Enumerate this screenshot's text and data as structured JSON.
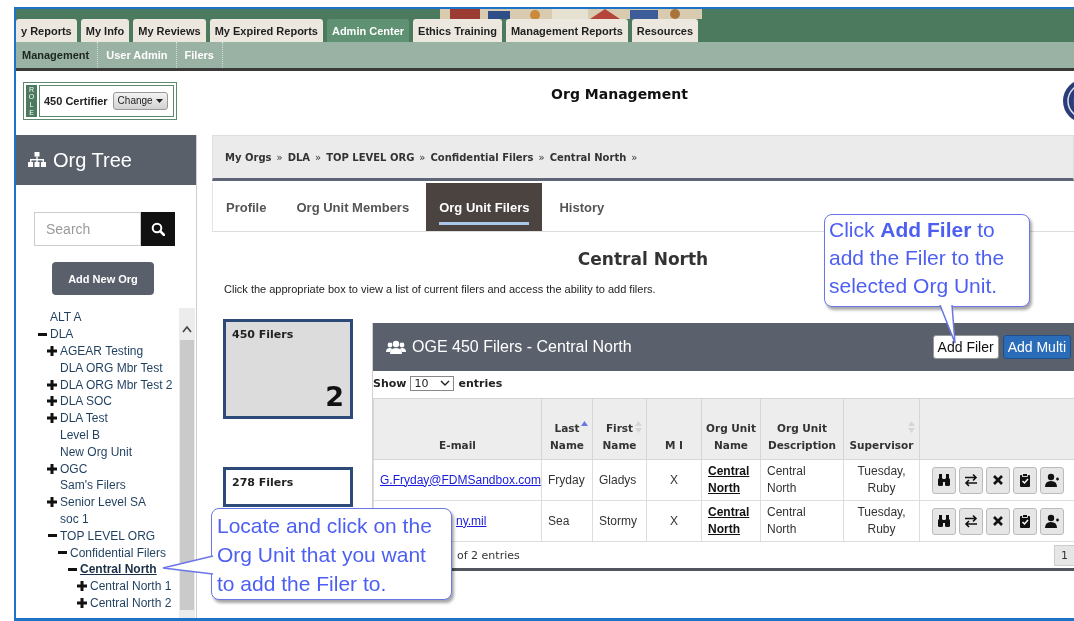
{
  "top_tabs": [
    {
      "label": "y Reports",
      "selected": false
    },
    {
      "label": "My Info",
      "selected": false
    },
    {
      "label": "My Reviews",
      "selected": false
    },
    {
      "label": "My Expired Reports",
      "selected": false
    },
    {
      "label": "Admin Center",
      "selected": true
    },
    {
      "label": "Ethics Training",
      "selected": false
    },
    {
      "label": "Management Reports",
      "selected": false
    },
    {
      "label": "Resources",
      "selected": false
    }
  ],
  "sub_tabs": [
    {
      "label": "Management",
      "selected": true
    },
    {
      "label": "User Admin",
      "selected": false
    },
    {
      "label": "Filers",
      "selected": false
    }
  ],
  "role": {
    "tag": "ROLE",
    "name": "450 Certifier",
    "button": "Change"
  },
  "page_title": "Org Management",
  "sidebar": {
    "title": "Org Tree",
    "search": {
      "placeholder": "Search"
    },
    "add_button": "Add New Org",
    "tree": [
      {
        "label": "ALT A",
        "kind": "leaf",
        "selected": false
      },
      {
        "label": "DLA",
        "kind": "node",
        "expanded": true,
        "selected": false,
        "children": [
          {
            "label": "AGEAR Testing",
            "kind": "node",
            "expanded": false,
            "selected": false
          },
          {
            "label": "DLA ORG Mbr Test",
            "kind": "leaf",
            "selected": false
          },
          {
            "label": "DLA ORG Mbr Test 2",
            "kind": "node",
            "expanded": false,
            "selected": false
          },
          {
            "label": "DLA SOC",
            "kind": "node",
            "expanded": false,
            "selected": false
          },
          {
            "label": "DLA Test",
            "kind": "node",
            "expanded": false,
            "selected": false
          },
          {
            "label": "Level B",
            "kind": "leaf",
            "selected": false
          },
          {
            "label": "New Org Unit",
            "kind": "leaf",
            "selected": false
          },
          {
            "label": "OGC",
            "kind": "node",
            "expanded": false,
            "selected": false
          },
          {
            "label": "Sam's Filers",
            "kind": "leaf",
            "selected": false
          },
          {
            "label": "Senior Level SA",
            "kind": "node",
            "expanded": false,
            "selected": false
          },
          {
            "label": "soc 1",
            "kind": "leaf",
            "selected": false
          },
          {
            "label": "TOP LEVEL ORG",
            "kind": "node",
            "expanded": true,
            "selected": false,
            "children": [
              {
                "label": "Confidential Filers",
                "kind": "node",
                "expanded": true,
                "selected": false,
                "children": [
                  {
                    "label": "Central North",
                    "kind": "node",
                    "expanded": true,
                    "selected": true,
                    "children": [
                      {
                        "label": "Central North 1",
                        "kind": "node",
                        "expanded": false,
                        "selected": false
                      },
                      {
                        "label": "Central North 2",
                        "kind": "node",
                        "expanded": false,
                        "selected": false
                      }
                    ]
                  }
                ]
              }
            ]
          }
        ]
      }
    ]
  },
  "breadcrumb": {
    "items": [
      "My Orgs",
      "DLA",
      "TOP LEVEL ORG",
      "Confidential Filers",
      "Central North"
    ],
    "separator": "»"
  },
  "tabs": [
    {
      "label": "Profile",
      "selected": false
    },
    {
      "label": "Org Unit Members",
      "selected": false
    },
    {
      "label": "Org Unit Filers",
      "selected": true
    },
    {
      "label": "History",
      "selected": false
    }
  ],
  "heading": "Central North",
  "description": "Click the appropriate box to view a list of current filers and access the ability to add filers.",
  "filer_boxes": [
    {
      "label": "450 Filers",
      "count": "2",
      "selected": true
    },
    {
      "label": "278 Filers",
      "selected": false
    }
  ],
  "panel": {
    "title": "OGE 450 Filers - Central North",
    "buttons": [
      {
        "label": "Add Filer",
        "kind": "outline"
      },
      {
        "label": "Add Multi",
        "kind": "primary"
      }
    ],
    "show": {
      "before": "Show",
      "value": "10",
      "after": "entries"
    },
    "columns": [
      {
        "label": "E-mail",
        "sortable": false,
        "sorted": false
      },
      {
        "label": "Last Name",
        "sortable": true,
        "sorted": true
      },
      {
        "label": "First Name",
        "sortable": true,
        "sorted": false
      },
      {
        "label": "M I",
        "sortable": false,
        "sorted": false
      },
      {
        "label": "Org Unit Name",
        "sortable": false,
        "sorted": false
      },
      {
        "label": "Org Unit Description",
        "sortable": false,
        "sorted": false
      },
      {
        "label": "Supervisor",
        "sortable": true,
        "sorted": false
      }
    ],
    "rows": [
      {
        "email": "G.Fryday@FDMSandbox.com",
        "last": "Fryday",
        "first": "Gladys",
        "mi": "X",
        "org_unit": "Central North",
        "description": "Central North",
        "supervisor": "Tuesday, Ruby",
        "actions": [
          {
            "kind": "view"
          },
          {
            "kind": "transfer"
          },
          {
            "kind": "remove"
          },
          {
            "kind": "certify"
          },
          {
            "kind": "add_user"
          }
        ]
      },
      {
        "email": "ny.mil",
        "last": "Sea",
        "first": "Stormy",
        "mi": "X",
        "org_unit": "Central North",
        "description": "Central North",
        "supervisor": "Tuesday, Ruby",
        "actions": [
          {
            "kind": "view"
          },
          {
            "kind": "transfer"
          },
          {
            "kind": "remove"
          },
          {
            "kind": "certify"
          },
          {
            "kind": "add_user"
          }
        ]
      }
    ],
    "info": "of 2 entries",
    "pages": [
      {
        "label": "1",
        "selected": true
      }
    ]
  },
  "callouts": [
    {
      "text": "Click **Add Filer** to add the Filer to the selected Org Unit."
    },
    {
      "text": "Locate and click on the Org Unit that you want to add the Filer to."
    }
  ]
}
